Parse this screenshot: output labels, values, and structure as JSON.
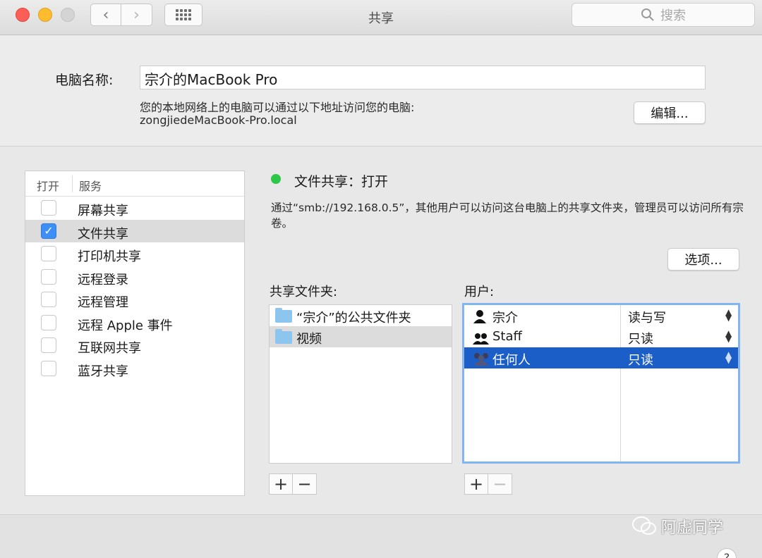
{
  "window": {
    "title": "共享",
    "search_placeholder": "搜索"
  },
  "computer": {
    "name_label": "电脑名称:",
    "name_value": "宗介的MacBook Pro",
    "address_desc": "您的本地网络上的电脑可以通过以下地址访问您的电脑:",
    "address": "zongjiedeMacBook-Pro.local",
    "edit_label": "编辑..."
  },
  "services": {
    "col_on": "打开",
    "col_service": "服务",
    "items": [
      {
        "label": "屏幕共享",
        "checked": false
      },
      {
        "label": "文件共享",
        "checked": true
      },
      {
        "label": "打印机共享",
        "checked": false
      },
      {
        "label": "远程登录",
        "checked": false
      },
      {
        "label": "远程管理",
        "checked": false
      },
      {
        "label": "远程 Apple 事件",
        "checked": false
      },
      {
        "label": "互联网共享",
        "checked": false
      },
      {
        "label": "蓝牙共享",
        "checked": false
      }
    ]
  },
  "detail": {
    "status": "文件共享：打开",
    "status_color": "#2cc84a",
    "description": "通过“smb://192.168.0.5”，其他用户可以访问这台电脑上的共享文件夹，管理员可以访问所有宗卷。",
    "options_label": "选项...",
    "folders_label": "共享文件夹:",
    "users_label": "用户:",
    "folders": [
      {
        "name": "“宗介”的公共文件夹"
      },
      {
        "name": "视频"
      }
    ],
    "users": [
      {
        "name": "宗介",
        "permission": "读与写"
      },
      {
        "name": "Staff",
        "permission": "只读"
      },
      {
        "name": "任何人",
        "permission": "只读"
      }
    ],
    "plus": "+",
    "minus": "−"
  },
  "watermark": "阿虚同学",
  "help": "?"
}
